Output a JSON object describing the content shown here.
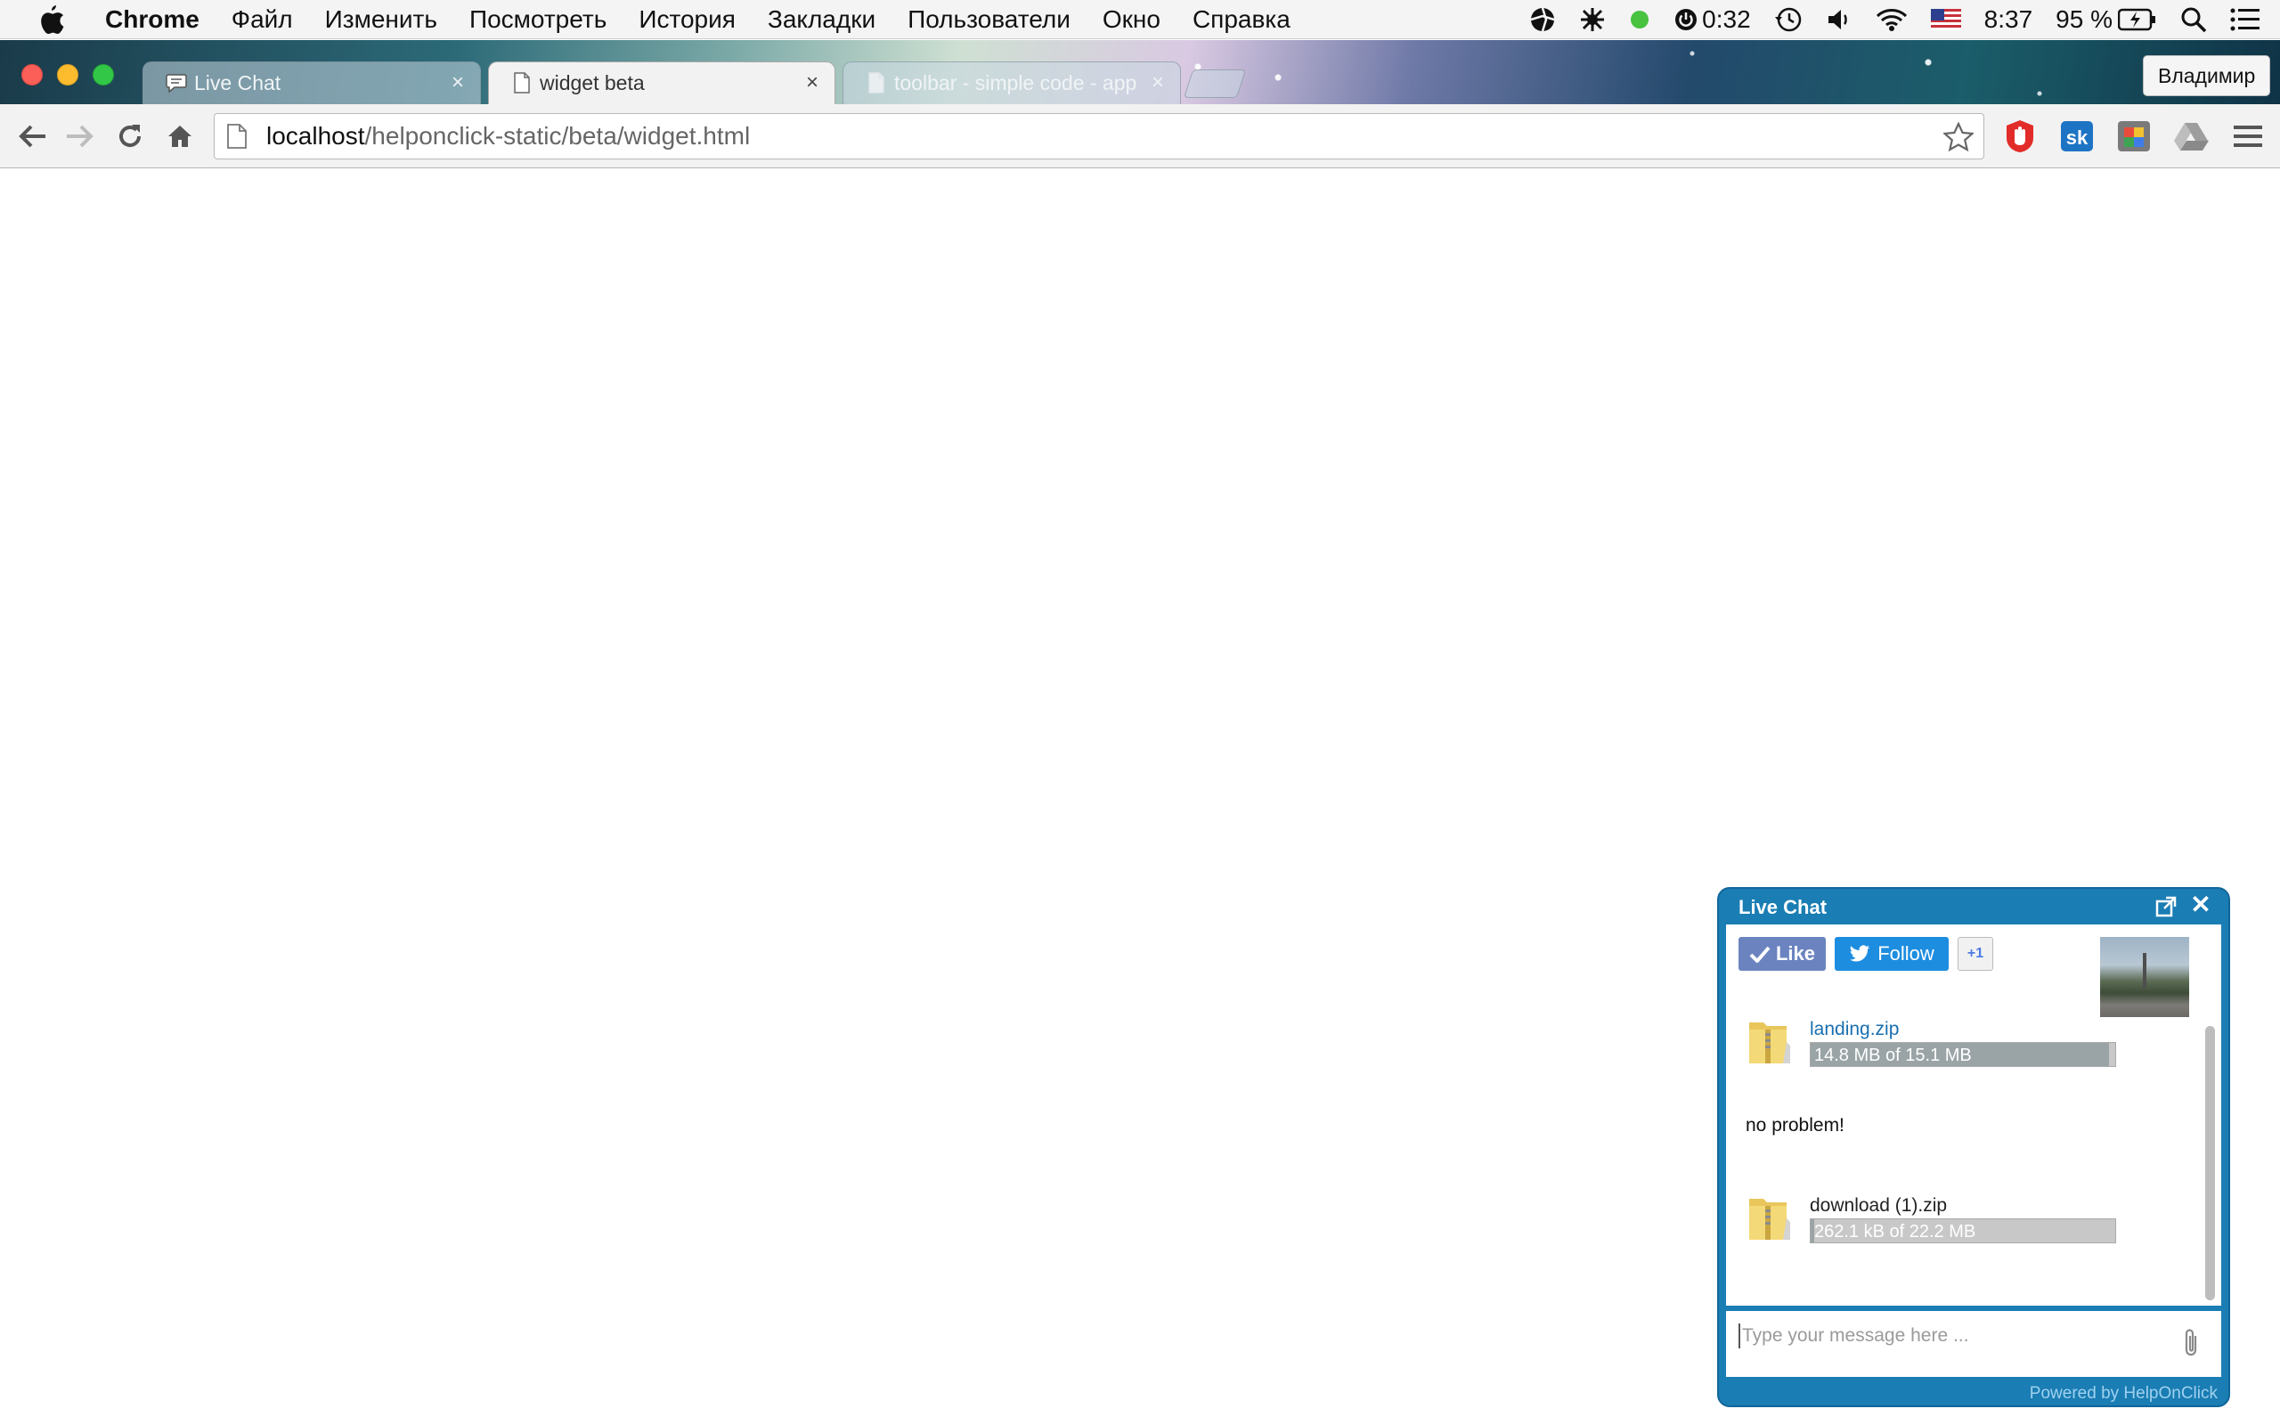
{
  "menubar": {
    "apple_icon": "apple-icon",
    "app_name": "Chrome",
    "items": [
      "Файл",
      "Изменить",
      "Посмотреть",
      "История",
      "Закладки",
      "Пользователи",
      "Окно",
      "Справка"
    ],
    "status": {
      "timer": "0:32",
      "time": "8:37",
      "battery": "95 %",
      "icons": [
        "aperture-icon",
        "brightness-icon",
        "green-dot-icon",
        "power-timer-icon",
        "time-machine-icon",
        "volume-icon",
        "wifi-icon",
        "us-flag-icon",
        "battery-charging-icon",
        "spotlight-icon",
        "notification-center-icon"
      ]
    }
  },
  "browser": {
    "tabs": [
      {
        "title": "Live Chat",
        "icon": "chat-bubble-icon",
        "active": false
      },
      {
        "title": "widget beta",
        "icon": "page-icon",
        "active": true
      },
      {
        "title": "toolbar - simple code - app",
        "icon": "page-icon",
        "active": false
      }
    ],
    "profile": "Владимир",
    "url_host": "localhost",
    "url_path": "/helponclick-static/beta/widget.html",
    "extensions": [
      "adblock-icon",
      "sk-extension-icon",
      "color-picker-icon",
      "drive-icon",
      "menu-icon"
    ]
  },
  "widget": {
    "title": "Live Chat",
    "social": {
      "like": "Like",
      "follow": "Follow",
      "gplus": "+1"
    },
    "messages": [
      {
        "type": "file",
        "name": "landing.zip",
        "progress_text": "14.8 MB of 15.1 MB",
        "progress": 0.98,
        "link": true
      },
      {
        "type": "text",
        "text": "no problem!"
      },
      {
        "type": "file",
        "name": "download (1).zip",
        "progress_text": "262.1 kB of 22.2 MB",
        "progress": 0.012,
        "link": false
      }
    ],
    "input_placeholder": "Type your message here ...",
    "powered_by": "Powered by HelpOnClick"
  },
  "colors": {
    "widget_blue": "#1a7db3",
    "link_blue": "#1a6fb0",
    "like_blue": "#6b84c0",
    "follow_blue": "#1d8de0"
  }
}
